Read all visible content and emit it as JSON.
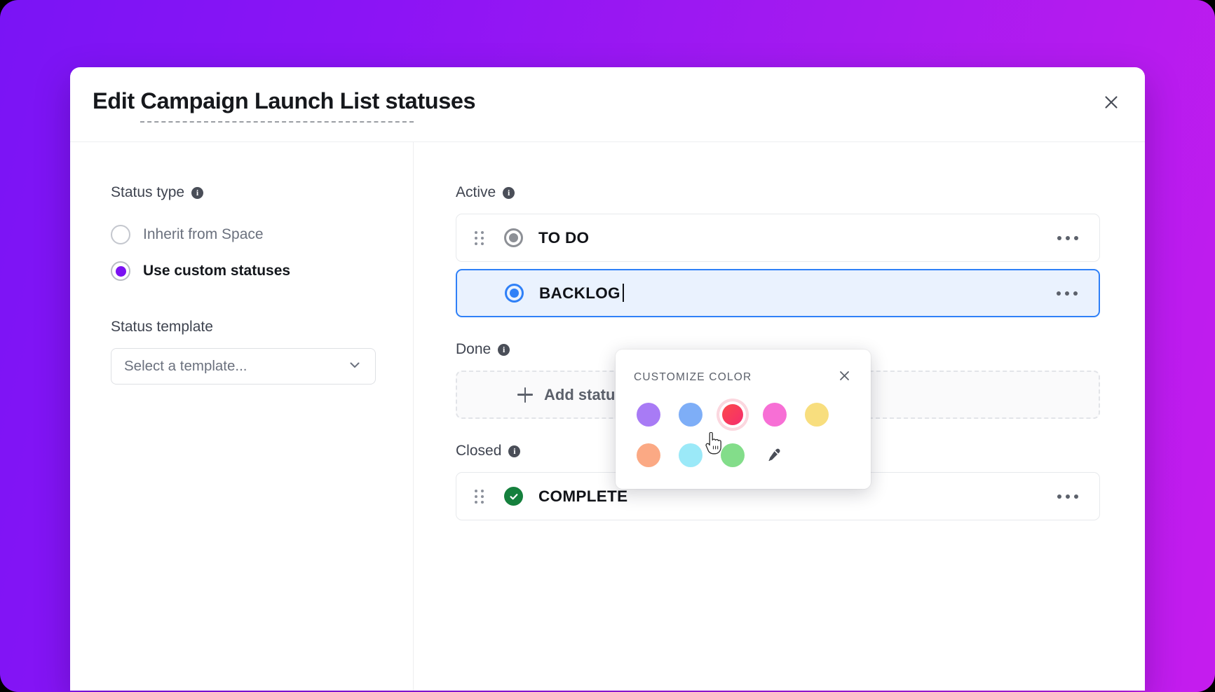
{
  "background": {
    "gradient_from": "#7A14F5",
    "gradient_to": "#C51CEE"
  },
  "modal": {
    "title": "Edit Campaign Launch List statuses",
    "close_label": "close-icon"
  },
  "left_pane": {
    "status_type": {
      "label": "Status type",
      "info": "i",
      "options": [
        {
          "label": "Inherit from Space",
          "selected": false
        },
        {
          "label": "Use custom statuses",
          "selected": true
        }
      ],
      "selected_color": "#7B11F2"
    },
    "status_template": {
      "label": "Status template",
      "value": "Select a template...",
      "placeholder": "Select a template..."
    }
  },
  "right_pane": {
    "sections": [
      {
        "title": "Active",
        "info": "i",
        "statuses": [
          {
            "name": "TO DO",
            "color": "#8D9096",
            "icon": "status-ring-icon",
            "selected": false
          },
          {
            "name": "BACKLOG",
            "color": "#2F80F7",
            "icon": "status-ring-icon",
            "selected": true,
            "editing": true
          }
        ],
        "add_status": null
      },
      {
        "title": "Done",
        "info": "i",
        "statuses": [],
        "add_status": "Add status"
      },
      {
        "title": "Closed",
        "info": "i",
        "statuses": [
          {
            "name": "COMPLETE",
            "color": "#15803D",
            "icon": "status-check-icon",
            "selected": false
          }
        ],
        "add_status": null
      }
    ]
  },
  "color_popover": {
    "title": "CUSTOMIZE COLOR",
    "close_label": "close-icon",
    "swatches": [
      {
        "name": "purple",
        "hex": "#A87BF5",
        "selected": false
      },
      {
        "name": "blue",
        "hex": "#7EAEF7",
        "selected": false
      },
      {
        "name": "red",
        "hex": "#F73F55",
        "selected": true
      },
      {
        "name": "pink",
        "hex": "#F76FD5",
        "selected": false
      },
      {
        "name": "yellow",
        "hex": "#F8DE7E",
        "selected": false
      },
      {
        "name": "peach",
        "hex": "#FBA984",
        "selected": false
      },
      {
        "name": "cyan",
        "hex": "#9BE9F8",
        "selected": false
      },
      {
        "name": "green",
        "hex": "#83DD8A",
        "selected": false
      }
    ],
    "eyedropper_label": "eyedropper-icon",
    "selected_ring_color": "#FBD6DE"
  }
}
